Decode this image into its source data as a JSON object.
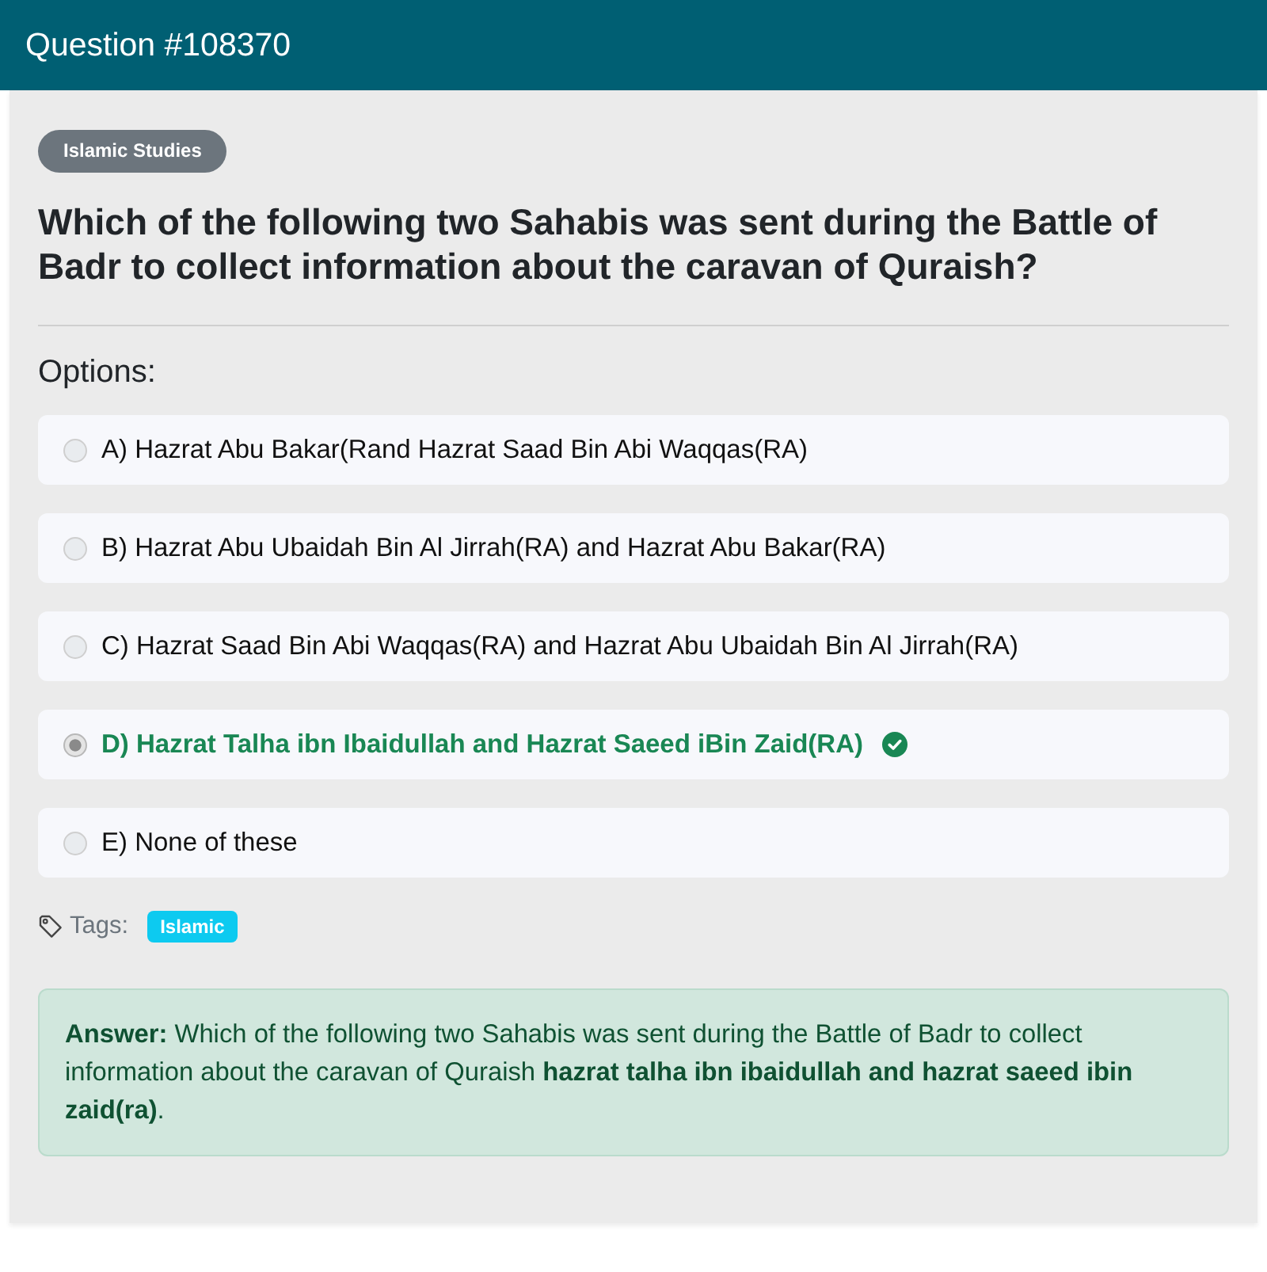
{
  "header": {
    "title": "Question #108370"
  },
  "category": "Islamic Studies",
  "question": "Which of the following two Sahabis was sent during the Battle of Badr to collect information about the caravan of Quraish?",
  "options_label": "Options:",
  "options": [
    {
      "label": "A) Hazrat Abu Bakar(Rand Hazrat Saad Bin Abi Waqqas(RA)",
      "selected": false,
      "correct": false
    },
    {
      "label": "B) Hazrat Abu Ubaidah Bin Al Jirrah(RA) and Hazrat Abu Bakar(RA)",
      "selected": false,
      "correct": false
    },
    {
      "label": "C) Hazrat Saad Bin Abi Waqqas(RA) and Hazrat Abu Ubaidah Bin Al Jirrah(RA)",
      "selected": false,
      "correct": false
    },
    {
      "label": "D) Hazrat Talha ibn Ibaidullah and Hazrat Saeed iBin Zaid(RA)",
      "selected": true,
      "correct": true
    },
    {
      "label": "E) None of these",
      "selected": false,
      "correct": false
    }
  ],
  "tags": {
    "label": "Tags:",
    "items": [
      "Islamic"
    ]
  },
  "answer": {
    "text": "**Answer:** Which of the following two Sahabis was sent during the Battle of Badr to collect information about the caravan of Quraish **hazrat talha ibn ibaidullah and hazrat saeed ibin zaid(ra)**."
  }
}
